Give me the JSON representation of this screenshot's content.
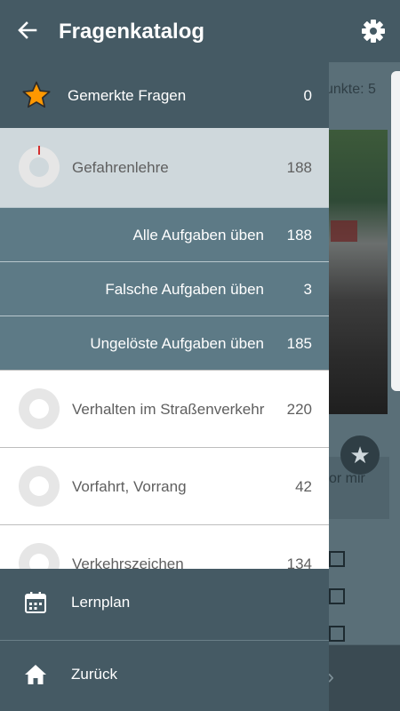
{
  "appbar": {
    "title": "Fragenkatalog"
  },
  "background": {
    "points_label": "unkte: 5",
    "box_text": "or mir"
  },
  "bookmarks": {
    "label": "Gemerkte Fragen",
    "count": "0"
  },
  "categories": [
    {
      "label": "Gefahrenlehre",
      "count": "188"
    },
    {
      "label": "Verhalten im Straßenverkehr",
      "count": "220"
    },
    {
      "label": "Vorfahrt, Vorrang",
      "count": "42"
    },
    {
      "label": "Verkehrszeichen",
      "count": "134"
    }
  ],
  "subitems": [
    {
      "label": "Alle Aufgaben üben",
      "count": "188"
    },
    {
      "label": "Falsche Aufgaben üben",
      "count": "3"
    },
    {
      "label": "Ungelöste Aufgaben üben",
      "count": "185"
    }
  ],
  "footer": {
    "plan_label": "Lernplan",
    "back_label": "Zurück"
  },
  "colors": {
    "primary": "#455a64",
    "sub": "#5d7a86",
    "active": "#cfd8dc",
    "star": "#ff9800",
    "progress_tick": "#d32f2f"
  },
  "icons": [
    "arrow-back-icon",
    "gear-icon",
    "star-icon",
    "progress-ring-icon",
    "calendar-icon",
    "home-icon",
    "chevron-right-icon"
  ]
}
